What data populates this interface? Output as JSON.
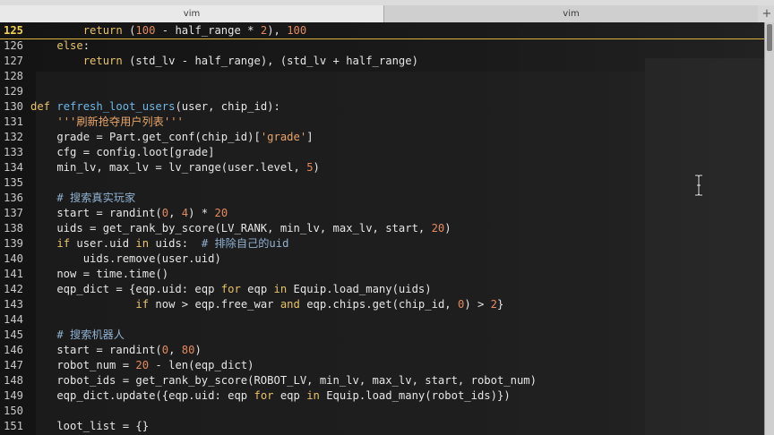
{
  "window": {
    "tabs": [
      {
        "label": "vim",
        "active": true
      },
      {
        "label": "vim",
        "active": false
      }
    ],
    "add_tab": "+"
  },
  "editor": {
    "current_line": 125,
    "lines": [
      {
        "n": "125",
        "t": [
          [
            "",
            "        "
          ],
          [
            "kw",
            "return"
          ],
          [
            "",
            " ("
          ],
          [
            "num",
            "100"
          ],
          [
            "",
            " - half_range * "
          ],
          [
            "num",
            "2"
          ],
          [
            "",
            "), "
          ],
          [
            "num",
            "100"
          ]
        ]
      },
      {
        "n": "126",
        "t": [
          [
            "",
            "    "
          ],
          [
            "kw",
            "else"
          ],
          [
            "",
            ":"
          ]
        ]
      },
      {
        "n": "127",
        "t": [
          [
            "",
            "        "
          ],
          [
            "kw",
            "return"
          ],
          [
            "",
            " (std_lv - half_range), (std_lv + half_range)"
          ]
        ]
      },
      {
        "n": "128",
        "t": []
      },
      {
        "n": "129",
        "t": []
      },
      {
        "n": "130",
        "t": [
          [
            "kw",
            "def"
          ],
          [
            "",
            " "
          ],
          [
            "fn",
            "refresh_loot_users"
          ],
          [
            "",
            "(user, chip_id):"
          ]
        ]
      },
      {
        "n": "131",
        "t": [
          [
            "",
            "    "
          ],
          [
            "str",
            "'''刷新抢夺用户列表'''"
          ]
        ]
      },
      {
        "n": "132",
        "t": [
          [
            "",
            "    grade = Part.get_conf(chip_id)["
          ],
          [
            "str",
            "'grade'"
          ],
          [
            "",
            "]"
          ]
        ]
      },
      {
        "n": "133",
        "t": [
          [
            "",
            "    cfg = config.loot[grade]"
          ]
        ]
      },
      {
        "n": "134",
        "t": [
          [
            "",
            "    min_lv, max_lv = lv_range(user.level, "
          ],
          [
            "num",
            "5"
          ],
          [
            "",
            ")"
          ]
        ]
      },
      {
        "n": "135",
        "t": []
      },
      {
        "n": "136",
        "t": [
          [
            "",
            "    "
          ],
          [
            "cm",
            "# 搜索真实玩家"
          ]
        ]
      },
      {
        "n": "137",
        "t": [
          [
            "",
            "    start = randint("
          ],
          [
            "num",
            "0"
          ],
          [
            "",
            ", "
          ],
          [
            "num",
            "4"
          ],
          [
            "",
            ") * "
          ],
          [
            "num",
            "20"
          ]
        ]
      },
      {
        "n": "138",
        "t": [
          [
            "",
            "    uids = get_rank_by_score(LV_RANK, min_lv, max_lv, start, "
          ],
          [
            "num",
            "20"
          ],
          [
            "",
            ")"
          ]
        ]
      },
      {
        "n": "139",
        "t": [
          [
            "",
            "    "
          ],
          [
            "kw",
            "if"
          ],
          [
            "",
            " user.uid "
          ],
          [
            "kw",
            "in"
          ],
          [
            "",
            " uids:  "
          ],
          [
            "cm",
            "# 排除自己的uid"
          ]
        ]
      },
      {
        "n": "140",
        "t": [
          [
            "",
            "        uids.remove(user.uid)"
          ]
        ]
      },
      {
        "n": "141",
        "t": [
          [
            "",
            "    now = time.time()"
          ]
        ]
      },
      {
        "n": "142",
        "t": [
          [
            "",
            "    eqp_dict = {eqp.uid: eqp "
          ],
          [
            "kw",
            "for"
          ],
          [
            "",
            " eqp "
          ],
          [
            "kw",
            "in"
          ],
          [
            "",
            " Equip.load_many(uids)"
          ]
        ]
      },
      {
        "n": "143",
        "t": [
          [
            "",
            "                "
          ],
          [
            "kw",
            "if"
          ],
          [
            "",
            " now > eqp.free_war "
          ],
          [
            "kw",
            "and"
          ],
          [
            "",
            " eqp.chips.get(chip_id, "
          ],
          [
            "num",
            "0"
          ],
          [
            "",
            ") > "
          ],
          [
            "num",
            "2"
          ],
          [
            "",
            "}"
          ]
        ]
      },
      {
        "n": "144",
        "t": []
      },
      {
        "n": "145",
        "t": [
          [
            "",
            "    "
          ],
          [
            "cm",
            "# 搜索机器人"
          ]
        ]
      },
      {
        "n": "146",
        "t": [
          [
            "",
            "    start = randint("
          ],
          [
            "num",
            "0"
          ],
          [
            "",
            ", "
          ],
          [
            "num",
            "80"
          ],
          [
            "",
            ")"
          ]
        ]
      },
      {
        "n": "147",
        "t": [
          [
            "",
            "    robot_num = "
          ],
          [
            "num",
            "20"
          ],
          [
            "",
            " - len(eqp_dict)"
          ]
        ]
      },
      {
        "n": "148",
        "t": [
          [
            "",
            "    robot_ids = get_rank_by_score(ROBOT_LV, min_lv, max_lv, start, robot_num)"
          ]
        ]
      },
      {
        "n": "149",
        "t": [
          [
            "",
            "    eqp_dict.update({eqp.uid: eqp "
          ],
          [
            "kw",
            "for"
          ],
          [
            "",
            " eqp "
          ],
          [
            "kw",
            "in"
          ],
          [
            "",
            " Equip.load_many(robot_ids)})"
          ]
        ]
      },
      {
        "n": "150",
        "t": []
      },
      {
        "n": "151",
        "t": [
          [
            "",
            "    loot_list = {}"
          ]
        ]
      }
    ]
  },
  "colors": {
    "background": "#141414",
    "text": "#e6e6e6",
    "keyword": "#e8c26a",
    "function": "#6fb7e6",
    "number": "#e58a5f",
    "string": "#e8a56a",
    "comment": "#8fb0d0",
    "current_line_number": "#f2d34e"
  },
  "icons": {
    "mouse_cursor": "text-ibeam-icon"
  }
}
